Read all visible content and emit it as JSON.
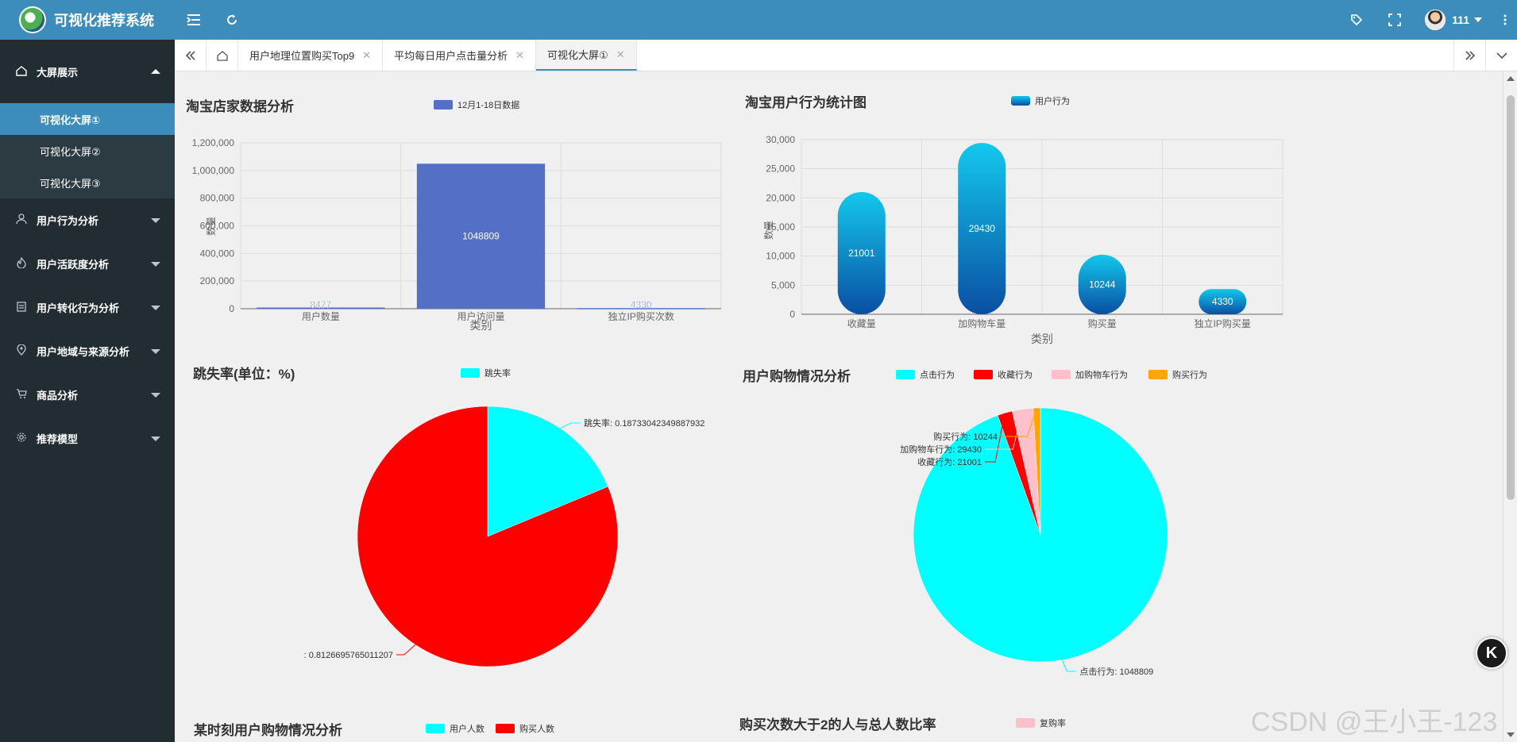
{
  "app": {
    "title": "可视化推荐系统",
    "user": "111"
  },
  "topbar": {
    "menu_icon": "menu-fold-icon",
    "refresh_icon": "refresh-icon",
    "tag_icon": "tag-icon",
    "fullscreen_icon": "fullscreen-icon",
    "more_icon": "more-vertical-icon"
  },
  "sidebar": {
    "open_menu": {
      "label": "大屏展示",
      "items": [
        "可视化大屏①",
        "可视化大屏②",
        "可视化大屏③"
      ],
      "active_index": 0
    },
    "menus": [
      {
        "label": "用户行为分析",
        "icon": "user-icon"
      },
      {
        "label": "用户活跃度分析",
        "icon": "fire-icon"
      },
      {
        "label": "用户转化行为分析",
        "icon": "clipboard-icon"
      },
      {
        "label": "用户地域与来源分析",
        "icon": "location-icon"
      },
      {
        "label": "商品分析",
        "icon": "cart-icon"
      },
      {
        "label": "推荐模型",
        "icon": "gear-icon"
      }
    ]
  },
  "tabs": {
    "items": [
      "用户地理位置购买Top9",
      "平均每日用户点击量分析",
      "可视化大屏①"
    ],
    "active_index": 2
  },
  "colors": {
    "brand": "#3c8dbc",
    "sidebar": "#222d32",
    "bar_blue": "#5470c6",
    "cyan": "#00ffff",
    "red": "#ff0000",
    "pink": "#ffc0cb",
    "orange": "#ffa500"
  },
  "chart_data": [
    {
      "type": "bar",
      "title": "淘宝店家数据分析",
      "legend": "12月1-18日数据",
      "categories": [
        "用户数量",
        "用户访问量",
        "独立IP购买次数"
      ],
      "values": [
        8477,
        1048809,
        4330
      ],
      "xlabel": "类别",
      "ylabel": "数量",
      "ylim": [
        0,
        1200000
      ],
      "yticks": [
        "0",
        "200,000",
        "400,000",
        "600,000",
        "800,000",
        "1,000,000",
        "1,200,000"
      ],
      "grid": true
    },
    {
      "type": "bar",
      "title": "淘宝用户行为统计图",
      "legend": "用户行为",
      "categories": [
        "收藏量",
        "加购物车量",
        "购买量",
        "独立IP购买量"
      ],
      "values": [
        21001,
        29430,
        10244,
        4330
      ],
      "xlabel": "类别",
      "ylabel": "数量",
      "ylim": [
        0,
        30000
      ],
      "yticks": [
        "0",
        "5,000",
        "10,000",
        "15,000",
        "20,000",
        "25,000",
        "30,000"
      ],
      "grid": true
    },
    {
      "type": "pie",
      "title": "跳失率(单位：%)",
      "legend": [
        "跳失率"
      ],
      "slices": [
        {
          "name": "跳失率",
          "value": 0.18733042349887932,
          "label": "跳失率: 0.18733042349887932"
        },
        {
          "name": "",
          "value": 0.8126695765011207,
          "label": ": 0.8126695765011207"
        }
      ]
    },
    {
      "type": "pie",
      "title": "用户购物情况分析",
      "legend": [
        "点击行为",
        "收藏行为",
        "加购物车行为",
        "购买行为"
      ],
      "slices": [
        {
          "name": "点击行为",
          "value": 1048809,
          "label": "点击行为: 1048809"
        },
        {
          "name": "收藏行为",
          "value": 21001,
          "label": "收藏行为: 21001"
        },
        {
          "name": "加购物车行为",
          "value": 29430,
          "label": "加购物车行为: 29430"
        },
        {
          "name": "购买行为",
          "value": 10244,
          "label": "购买行为: 10244"
        }
      ]
    },
    {
      "type": "bar",
      "title": "某时刻用户购物情况分析",
      "legend": [
        "用户人数",
        "购买人数"
      ]
    },
    {
      "type": "pie",
      "title": "购买次数大于2的人与总人数比率",
      "legend": [
        "复购率"
      ]
    }
  ],
  "badge": "K",
  "watermark": "CSDN @王小王-123"
}
